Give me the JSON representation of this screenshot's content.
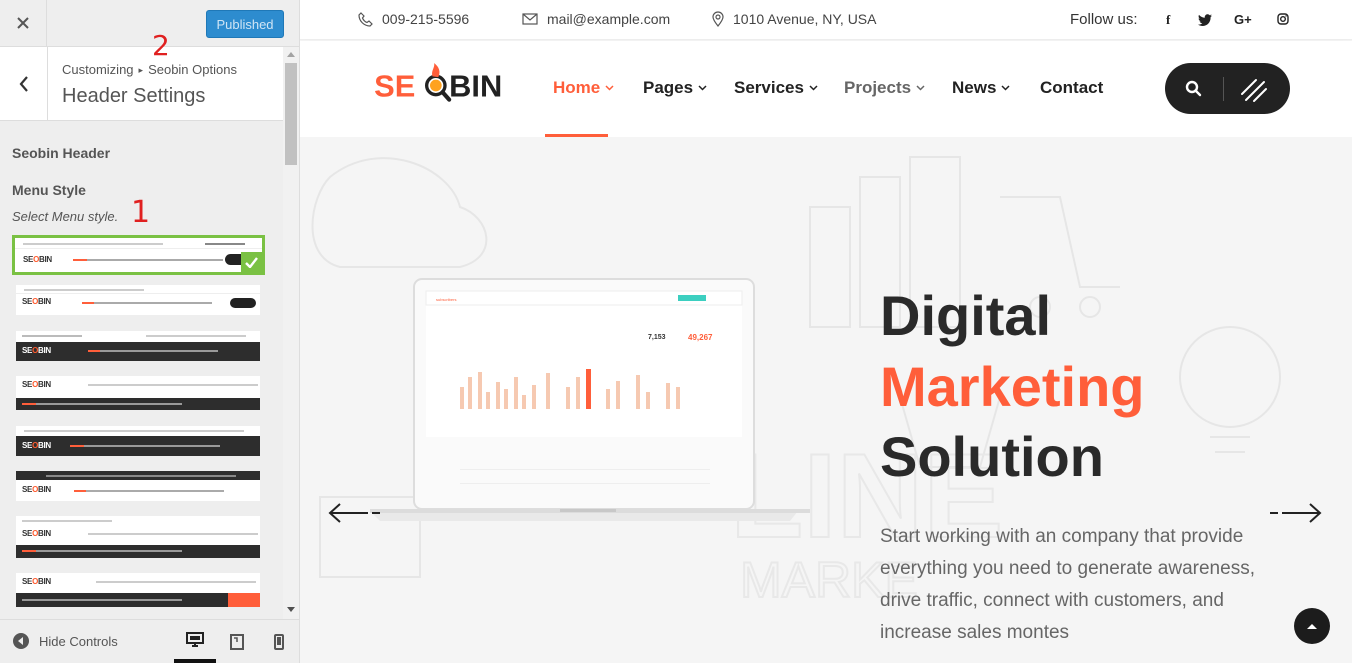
{
  "customizer": {
    "close_icon": "close-icon",
    "publish_label": "Published",
    "breadcrumb": {
      "root": "Customizing",
      "parent": "Seobin Options"
    },
    "section_title": "Header Settings",
    "group_title": "Seobin Header",
    "field_label": "Menu Style",
    "field_description": "Select Menu style.",
    "annotations": {
      "step_one": "1",
      "step_two": "2"
    },
    "menu_style_options": [
      {
        "selected": true,
        "logo": "SEOBIN"
      },
      {
        "selected": false,
        "logo": "SEOBIN"
      },
      {
        "selected": false,
        "logo": "SEOBIN"
      },
      {
        "selected": false,
        "logo": "SEOBIN"
      },
      {
        "selected": false,
        "logo": "SEOBIN"
      },
      {
        "selected": false,
        "logo": "SEOBIN"
      },
      {
        "selected": false,
        "logo": "SEOBIN"
      },
      {
        "selected": false,
        "logo": "SEOBIN"
      }
    ],
    "footer": {
      "hide_controls_label": "Hide Controls",
      "devices": [
        "desktop",
        "tablet",
        "mobile"
      ],
      "active_device": "desktop"
    }
  },
  "preview": {
    "topbar": {
      "phone": "009-215-5596",
      "email": "mail@example.com",
      "address": "1010 Avenue, NY, USA",
      "follow_label": "Follow us:",
      "socials": [
        "f",
        "",
        "G+",
        ""
      ]
    },
    "logo": {
      "left": "SE",
      "right": "BIN"
    },
    "nav": [
      {
        "label": "Home",
        "dropdown": true,
        "state": "active"
      },
      {
        "label": "Pages",
        "dropdown": true,
        "state": "normal"
      },
      {
        "label": "Services",
        "dropdown": true,
        "state": "normal"
      },
      {
        "label": "Projects",
        "dropdown": true,
        "state": "muted"
      },
      {
        "label": "News",
        "dropdown": true,
        "state": "normal"
      },
      {
        "label": "Contact",
        "dropdown": false,
        "state": "normal"
      }
    ],
    "hero": {
      "line1": "Digital",
      "line2": "Marketing",
      "line3": "Solution",
      "description": "Start working with an company that provide everything you need to generate awareness, drive traffic, connect with customers, and increase sales montes"
    },
    "laptop_screen": {
      "stat_one": "7,153",
      "stat_two": "49,267"
    }
  },
  "colors": {
    "accent": "#ff5e3a",
    "publish_button": "#2d8ccf",
    "selected_border": "#7ac143",
    "annotation": "#e02020"
  }
}
